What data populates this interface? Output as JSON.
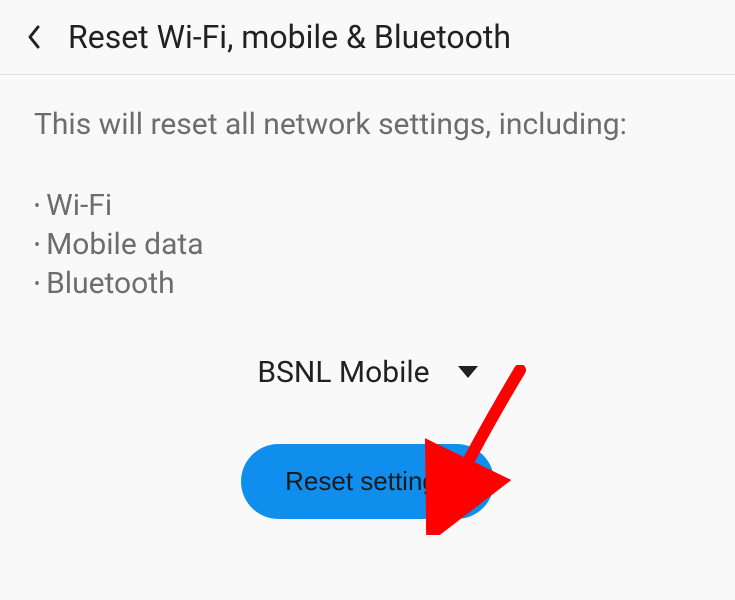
{
  "header": {
    "title": "Reset Wi-Fi, mobile & Bluetooth"
  },
  "body": {
    "description": "This will reset all network settings, including:",
    "items": {
      "0": "Wi-Fi",
      "1": "Mobile data",
      "2": "Bluetooth"
    }
  },
  "dropdown": {
    "selected": "BSNL Mobile"
  },
  "action": {
    "reset_label": "Reset settings"
  }
}
